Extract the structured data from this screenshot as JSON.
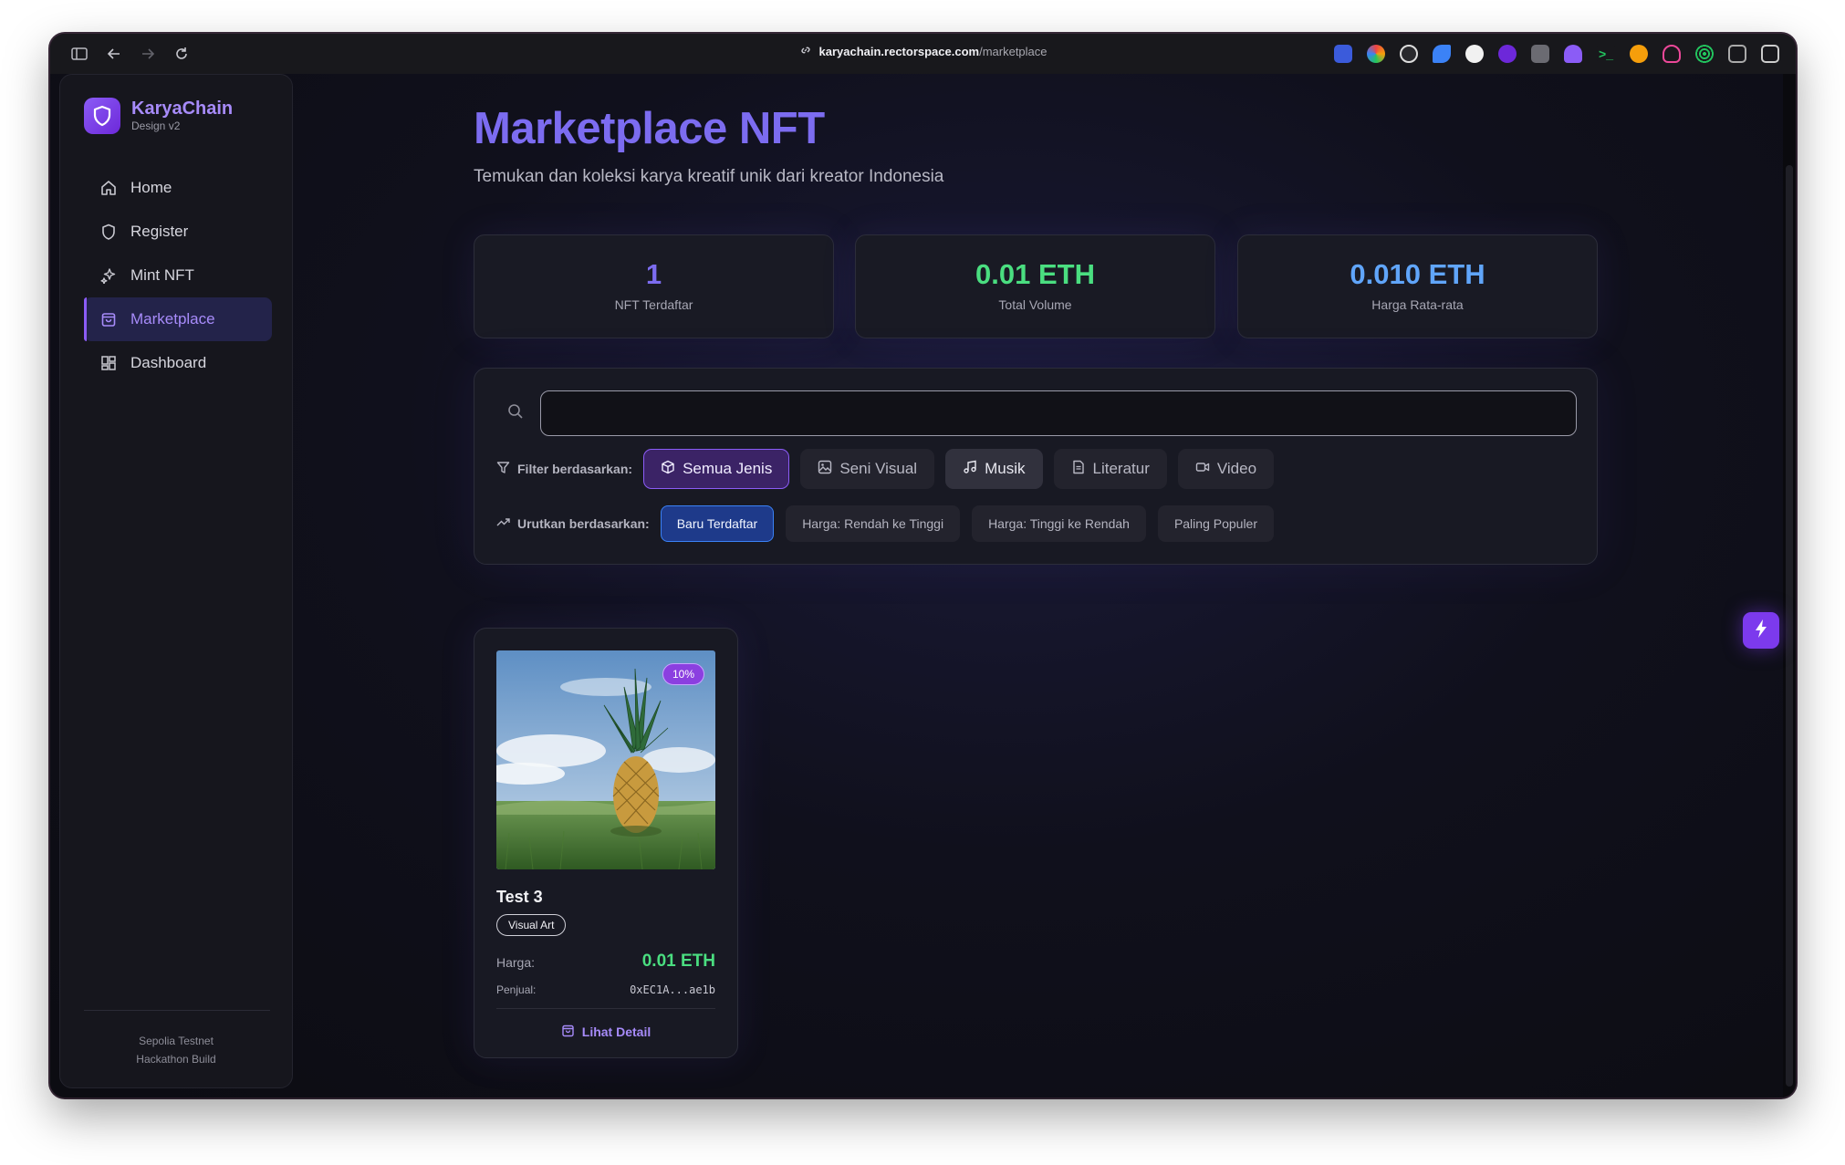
{
  "browser": {
    "url_domain": "karyachain.rectorspace.com",
    "url_path": "/marketplace"
  },
  "brand": {
    "name": "KaryaChain",
    "subtitle": "Design v2"
  },
  "sidebar": {
    "items": [
      {
        "label": "Home",
        "icon": "home-icon"
      },
      {
        "label": "Register",
        "icon": "shield-icon"
      },
      {
        "label": "Mint NFT",
        "icon": "sparkles-icon"
      },
      {
        "label": "Marketplace",
        "icon": "shopping-bag-icon",
        "active": true
      },
      {
        "label": "Dashboard",
        "icon": "dashboard-grid-icon"
      }
    ],
    "footer_line1": "Sepolia Testnet",
    "footer_line2": "Hackathon Build"
  },
  "page": {
    "title": "Marketplace NFT",
    "subtitle": "Temukan dan koleksi karya kreatif unik dari kreator Indonesia"
  },
  "stats": [
    {
      "value": "1",
      "label": "NFT Terdaftar",
      "color": "#7c6cf0"
    },
    {
      "value": "0.01 ETH",
      "label": "Total Volume",
      "color": "#4ade80"
    },
    {
      "value": "0.010 ETH",
      "label": "Harga Rata-rata",
      "color": "#60a5fa"
    }
  ],
  "search": {
    "value": "",
    "placeholder": ""
  },
  "filter": {
    "label": "Filter berdasarkan:",
    "options": [
      {
        "label": "Semua Jenis",
        "icon": "box-icon",
        "state": "active"
      },
      {
        "label": "Seni Visual",
        "icon": "image-icon",
        "state": "default"
      },
      {
        "label": "Musik",
        "icon": "music-icon",
        "state": "hover"
      },
      {
        "label": "Literatur",
        "icon": "document-icon",
        "state": "default"
      },
      {
        "label": "Video",
        "icon": "video-icon",
        "state": "default"
      }
    ]
  },
  "sort": {
    "label": "Urutkan berdasarkan:",
    "options": [
      {
        "label": "Baru Terdaftar",
        "state": "active"
      },
      {
        "label": "Harga: Rendah ke Tinggi",
        "state": "default"
      },
      {
        "label": "Harga: Tinggi ke Rendah",
        "state": "default"
      },
      {
        "label": "Paling Populer",
        "state": "default"
      }
    ]
  },
  "nft_card": {
    "badge": "10%",
    "title": "Test 3",
    "tag": "Visual Art",
    "price_label": "Harga:",
    "price": "0.01 ETH",
    "seller_label": "Penjual:",
    "seller": "0xEC1A...ae1b",
    "link_label": "Lihat Detail"
  },
  "colors": {
    "accent": "#8b5cf6",
    "green": "#4ade80",
    "blue": "#60a5fa"
  }
}
